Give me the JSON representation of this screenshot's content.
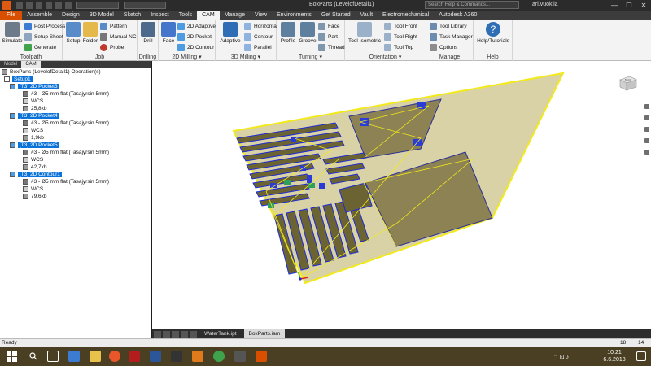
{
  "titlebar": {
    "title": "BoxParts (LevelofDetail1)",
    "search_placeholder": "Search Help & Commands...",
    "user": "ari.vuokila",
    "minimize": "—",
    "restore": "❐",
    "close": "✕"
  },
  "tabs": [
    "File",
    "Assemble",
    "Design",
    "3D Model",
    "Sketch",
    "Inspect",
    "Tools",
    "CAM",
    "Manage",
    "View",
    "Environments",
    "Get Started",
    "Vault",
    "Electromechanical",
    "Autodesk A360"
  ],
  "active_tab": "CAM",
  "ribbon": {
    "toolpath": {
      "label": "Toolpath",
      "simulate": "Simulate",
      "post_process": "Post Process",
      "setup_sheet": "Setup Sheet",
      "generate": "Generate"
    },
    "job": {
      "label": "Job",
      "setup": "Setup",
      "folder": "Folder",
      "pattern": "Pattern",
      "manual_nc": "Manual NC",
      "probe": "Probe"
    },
    "drilling": {
      "label": "Drilling",
      "drill": "Drill"
    },
    "milling2d": {
      "label": "2D Milling ▾",
      "face": "Face",
      "adaptive": "2D Adaptive",
      "pocket": "2D Pocket",
      "contour": "2D Contour"
    },
    "milling3d": {
      "label": "3D Milling ▾",
      "adaptive": "Adaptive",
      "horizontal": "Horizontal",
      "contour": "Contour",
      "parallel": "Parallel"
    },
    "turning": {
      "label": "Turning ▾",
      "profile": "Profile",
      "groove": "Groove",
      "face": "Face",
      "part": "Part",
      "thread": "Thread"
    },
    "orientation": {
      "label": "Orientation ▾",
      "tool_isometric": "Tool Isometric",
      "tool_front": "Tool Front",
      "tool_right": "Tool Right",
      "tool_top": "Tool Top"
    },
    "manage": {
      "label": "Manage",
      "tool_library": "Tool Library",
      "task_manager": "Task Manager",
      "options": "Options"
    },
    "help": {
      "label": "Help",
      "help_tutorials": "Help/Tutorials"
    }
  },
  "browser": {
    "tabs": [
      "Model",
      "CAM"
    ],
    "active_tab": "CAM",
    "add_tab": "+",
    "root": "BoxParts (LevelofDetail1) Operation(s)",
    "setup": "Setup1",
    "operations": [
      {
        "name": "[T3] 2D Pocket3",
        "tool": "#3 - Ø5 mm flat (Tasajyrsin 5mm)",
        "wcs": "WCS",
        "size": "25,8kb"
      },
      {
        "name": "[T3] 2D Pocket4",
        "tool": "#3 - Ø5 mm flat (Tasajyrsin 5mm)",
        "wcs": "WCS",
        "size": "1,9kb"
      },
      {
        "name": "[T3] 2D Pocket5",
        "tool": "#3 - Ø5 mm flat (Tasajyrsin 5mm)",
        "wcs": "WCS",
        "size": "42,7kb"
      },
      {
        "name": "[T3] 2D Contour1",
        "tool": "#3 - Ø5 mm flat (Tasajyrsin 5mm)",
        "wcs": "WCS",
        "size": "79,6kb"
      }
    ]
  },
  "viewcube": {
    "face_label": "BACK"
  },
  "doctabs": [
    "WaterTank.ipt",
    "BoxParts.iam"
  ],
  "active_doc": "BoxParts.iam",
  "statusbar": {
    "status": "Ready",
    "count1": "18",
    "count2": "14"
  },
  "taskbar": {
    "time": "10.21",
    "date": "6.6.2018",
    "tray_lang": "⌃  ⊡  ♪"
  },
  "colors": {
    "file_tab": "#d94f00",
    "selection": "#0a72d9",
    "stock_outline": "#f2ea1a",
    "part_fill": "#6b6432",
    "toolpath_blue": "#1e2bd6"
  }
}
